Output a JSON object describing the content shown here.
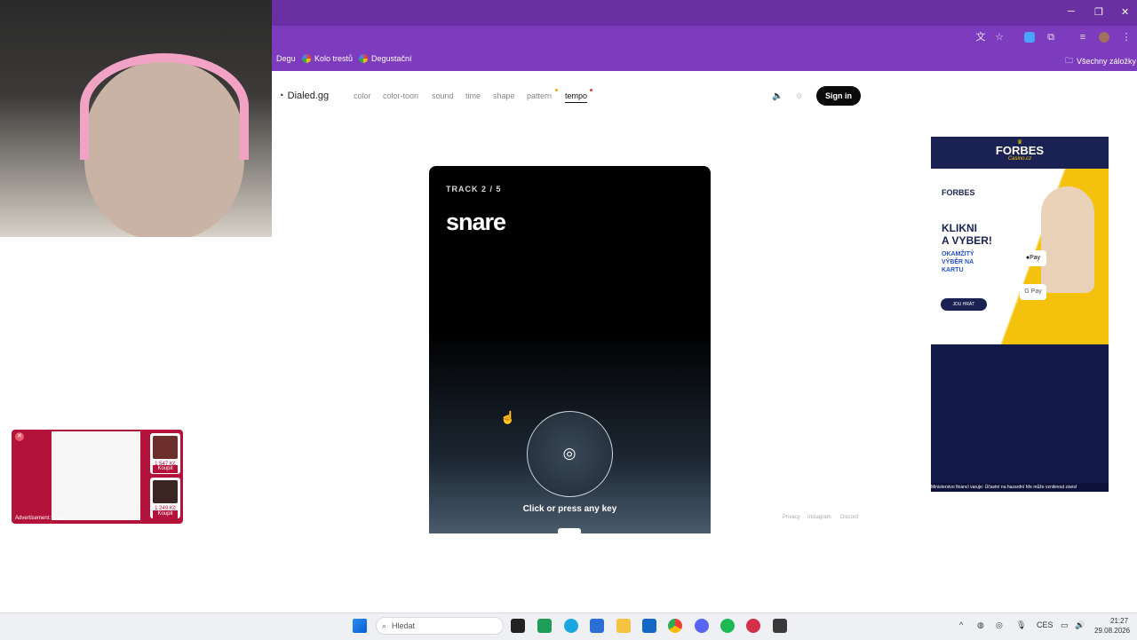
{
  "browser": {
    "bookmarks": [
      {
        "label": "Degu"
      },
      {
        "label": "Kolo trestů"
      },
      {
        "label": "Degustační"
      }
    ],
    "all_bookmarks_label": "Všechny záložky",
    "window_controls": {
      "minimize": "─",
      "restore": "❐",
      "close": "✕"
    }
  },
  "site": {
    "logo_text": "Dialed.gg",
    "nav": [
      {
        "label": "color"
      },
      {
        "label": "color-toon"
      },
      {
        "label": "sound"
      },
      {
        "label": "time"
      },
      {
        "label": "shape"
      },
      {
        "label": "pattern"
      },
      {
        "label": "tempo"
      }
    ],
    "active_nav": "tempo",
    "sign_in_label": "Sign in",
    "footer_links": [
      "Privacy",
      "Instagram",
      "Discord"
    ]
  },
  "game": {
    "track_label": "TRACK 2 / 5",
    "sound_name": "snare",
    "prompt": "Click or press any key"
  },
  "ad": {
    "brand": "FORBES",
    "brand_sub": "Casino.cz",
    "headline_1": "KLIKNI",
    "headline_2": "A VYBER!",
    "sub_1": "OKAMŽITÝ",
    "sub_2": "VÝBĚR NA",
    "sub_3": "KARTU",
    "cta": "JDU HRÁT",
    "apple_pay": "Pay",
    "google_pay": "G Pay",
    "notice": "Ministerstvo financí varuje: Účastní na hazardní hře může vzniknout závisl"
  },
  "mini_ad": {
    "label": "Advertisement: 0:00",
    "price_1": "1 547 Kč",
    "buy_1": "Koupit",
    "price_2": "1 249 Kč",
    "buy_2": "Koupit"
  },
  "taskbar": {
    "search_placeholder": "Hledat",
    "language": "CES",
    "time": "21:27",
    "date": "29.08.2026"
  },
  "colors": {
    "chrome_purple": "#7d3bbd",
    "card_dark": "#000000",
    "accent_dot": "#e53935"
  }
}
